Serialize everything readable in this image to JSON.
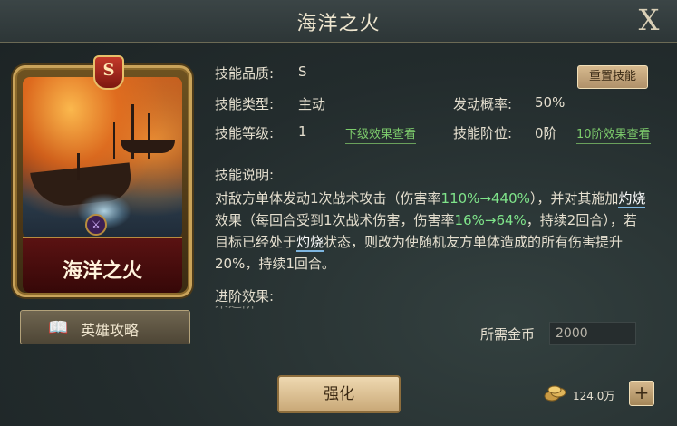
{
  "header": {
    "title": "海洋之火",
    "close_label": "X"
  },
  "card": {
    "grade": "S",
    "name": "海洋之火",
    "type_emblem": "⚔"
  },
  "guide_button": {
    "label": "英雄攻略",
    "icon": "book-icon"
  },
  "info": {
    "quality_label": "技能品质:",
    "quality_value": "S",
    "reset_label": "重置技能",
    "type_label": "技能类型:",
    "type_value": "主动",
    "rate_label": "发动概率:",
    "rate_value": "50%",
    "level_label": "技能等级:",
    "level_value": "1",
    "level_link": "下级效果查看",
    "stage_label": "技能阶位:",
    "stage_value": "0阶",
    "stage_link": "10阶效果查看"
  },
  "description": {
    "label": "技能说明:",
    "t1": "对敌方单体发动1次战术攻击（伤害率",
    "g1": "110%→440%",
    "t2": "），并对其施加",
    "k1": "灼烧",
    "t3": "效果（每回合受到1次战术伤害，伤害率",
    "g2": "16%→64%",
    "t4": "，持续2回合），若目标已经处于",
    "k2": "灼烧",
    "t5": "状态，则改为使随机友方单体造成的所有伤害提升20%，持续1回合。"
  },
  "advance": {
    "label": "进阶效果:",
    "partial_text": "未进阶"
  },
  "cost": {
    "label": "所需金币",
    "value": "2000"
  },
  "upgrade_button": {
    "label": "强化"
  },
  "currency": {
    "amount": "124.0万",
    "plus_label": "+",
    "icon": "coins-icon"
  },
  "colors": {
    "highlight_green": "#7fe48a",
    "link_green": "#7dcc6c",
    "keyword_underline": "#7eb6e0"
  }
}
